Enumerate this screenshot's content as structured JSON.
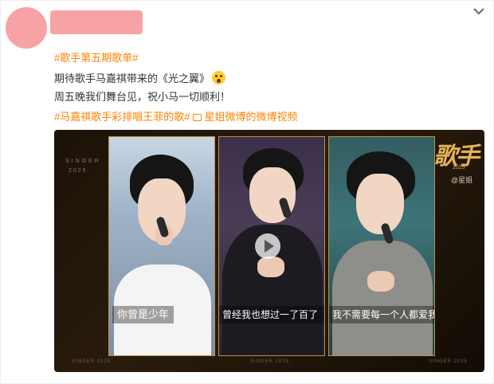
{
  "post": {
    "lines": {
      "l1_topic": "#歌手第五期歌单#",
      "l2_text": "期待歌手马嘉祺带来的《光之翼》",
      "l3_text": "周五晚我们舞台见，祝小马一切顺利！",
      "l4_topic": "#马嘉祺歌手彩排唱王菲的歌#",
      "l4_link": "星姐微博的微博视频"
    },
    "emoji_name": "scream-emoji"
  },
  "video": {
    "watermark_left": "SINGER",
    "watermark_year": "2025",
    "logo": "歌手",
    "logo_year": "2025",
    "logo_sub": "@星姐",
    "footer": [
      "SINGER 2025",
      "SINGER 2025",
      "SINGER 2025"
    ],
    "subtitles": [
      "你曾是少年",
      "曾经我也想过一了百了",
      "我不需要每一个人都爱我"
    ]
  },
  "colors": {
    "topic": "#ff8200",
    "mask": "#f7a3a6",
    "frame_gold": "#b8904a"
  }
}
